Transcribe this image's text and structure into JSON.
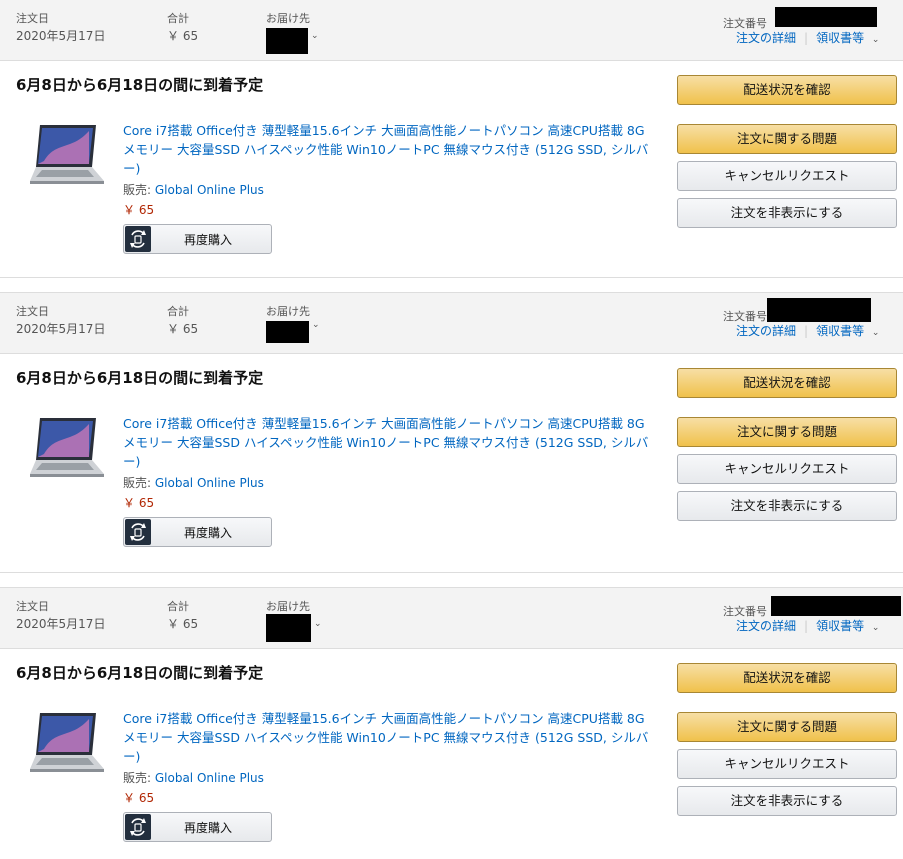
{
  "labels": {
    "order_date": "注文日",
    "total": "合計",
    "ship_to": "お届け先",
    "order_number": "注文番号",
    "order_details": "注文の詳細",
    "receipt": "領収書等",
    "seller_prefix": "販売: "
  },
  "icons": {
    "chevron": "chevron-down-icon",
    "rebuy": "rebuy-icon"
  },
  "orders": [
    {
      "date": "2020年5月17日",
      "total": "￥ 65",
      "delivery": "6月8日から6月18日の間に到着予定",
      "title": "Core i7搭載 Office付き 薄型軽量15.6インチ 大画面高性能ノートパソコン 高速CPU搭載 8Gメモリー 大容量SSD ハイスペック性能 Win10ノートPC 無線マウス付き (512G SSD, シルバー)",
      "seller": "Global Online Plus",
      "price": "￥ 65",
      "rebuy": "再度購入",
      "buttons": {
        "track": "配送状況を確認",
        "problem": "注文に関する問題",
        "cancel": "キャンセルリクエスト",
        "hide": "注文を非表示にする"
      }
    },
    {
      "date": "2020年5月17日",
      "total": "￥ 65",
      "delivery": "6月8日から6月18日の間に到着予定",
      "title": "Core i7搭載 Office付き 薄型軽量15.6インチ 大画面高性能ノートパソコン 高速CPU搭載 8Gメモリー 大容量SSD ハイスペック性能 Win10ノートPC 無線マウス付き (512G SSD, シルバー)",
      "seller": "Global Online Plus",
      "price": "￥ 65",
      "rebuy": "再度購入",
      "buttons": {
        "track": "配送状況を確認",
        "problem": "注文に関する問題",
        "cancel": "キャンセルリクエスト",
        "hide": "注文を非表示にする"
      }
    },
    {
      "date": "2020年5月17日",
      "total": "￥ 65",
      "delivery": "6月8日から6月18日の間に到着予定",
      "title": "Core i7搭載 Office付き 薄型軽量15.6インチ 大画面高性能ノートパソコン 高速CPU搭載 8Gメモリー 大容量SSD ハイスペック性能 Win10ノートPC 無線マウス付き (512G SSD, シルバー)",
      "seller": "Global Online Plus",
      "price": "￥ 65",
      "rebuy": "再度購入",
      "buttons": {
        "track": "配送状況を確認",
        "problem": "注文に関する問題",
        "cancel": "キャンセルリクエスト",
        "hide": "注文を非表示にする"
      }
    }
  ]
}
